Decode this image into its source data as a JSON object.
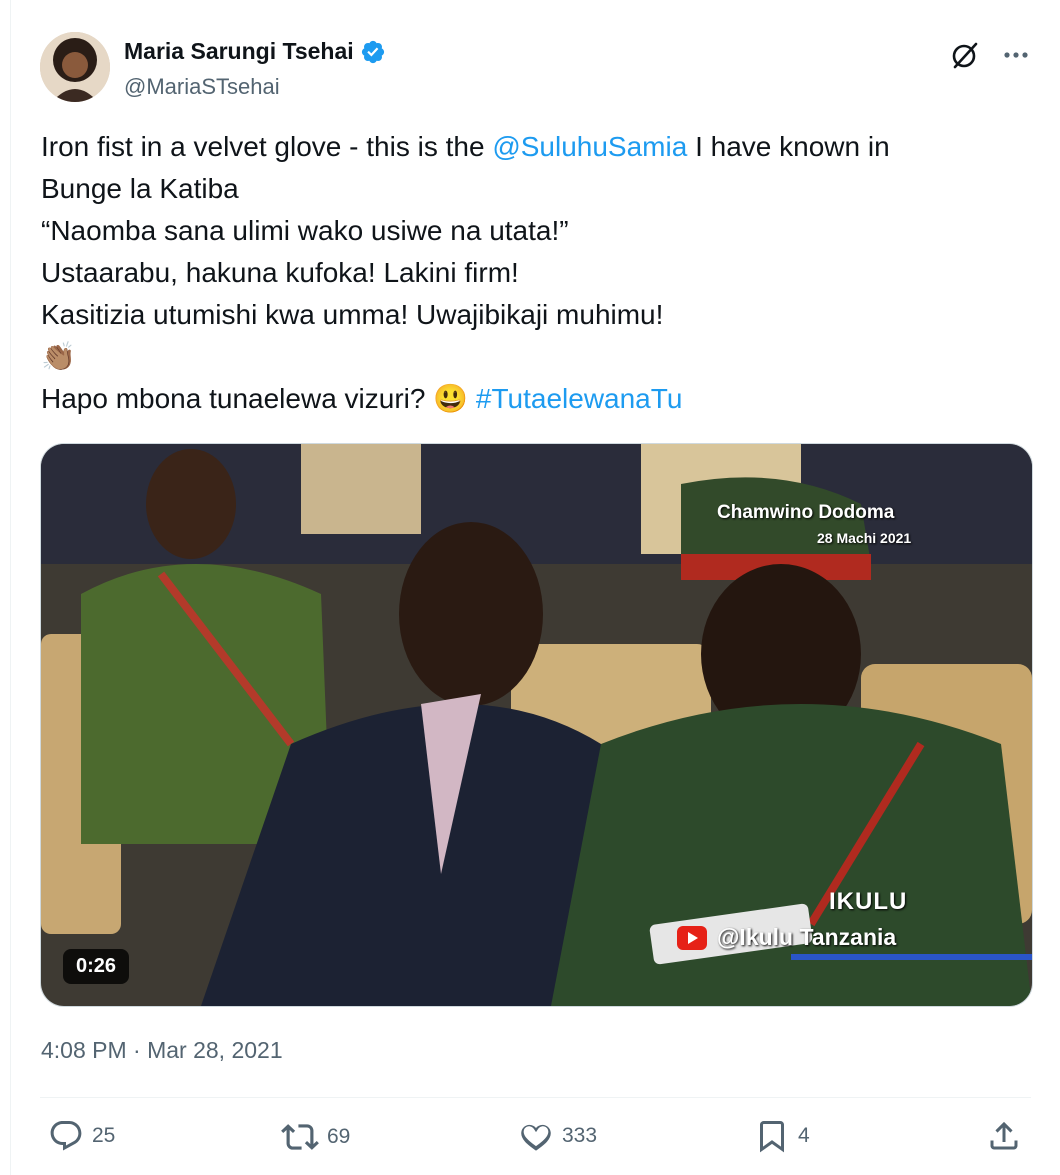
{
  "author": {
    "name": "Maria Sarungi Tsehai",
    "handle": "@MariaSTsehai",
    "verified": true
  },
  "tweet": {
    "line1_pre": "Iron fist in a velvet glove - this is the ",
    "line1_mention": "@SuluhuSamia",
    "line1_post": " I have known in",
    "line2": "Bunge la Katiba",
    "line3": "“Naomba sana ulimi wako usiwe na utata!”",
    "line4": "Ustaarabu, hakuna kufoka! Lakini firm!",
    "line5": "Kasitizia utumishi kwa umma! Uwajibikaji muhimu!",
    "line6_emoji": "👏🏽",
    "line7_pre": "Hapo mbona tunaelewa vizuri? ",
    "line7_emoji": "😃",
    "line7_hashtag": "#TutaelewanaTu"
  },
  "media": {
    "duration": "0:26",
    "overlay_location": "Chamwino Dodoma",
    "overlay_date": "28 Machi 2021",
    "overlay_brand": "IKULU",
    "overlay_channel": "@Ikulu Tanzania"
  },
  "timestamp": "4:08 PM · Mar 28, 2021",
  "actions": {
    "replies": "25",
    "reposts": "69",
    "likes": "333",
    "bookmarks": "4"
  },
  "icons": [
    "verified-icon",
    "grok-icon",
    "more-icon",
    "reply-icon",
    "repost-icon",
    "like-icon",
    "bookmark-icon",
    "share-icon"
  ],
  "colors": {
    "link": "#1d9bf0",
    "muted": "#536471",
    "text": "#0f1419"
  }
}
